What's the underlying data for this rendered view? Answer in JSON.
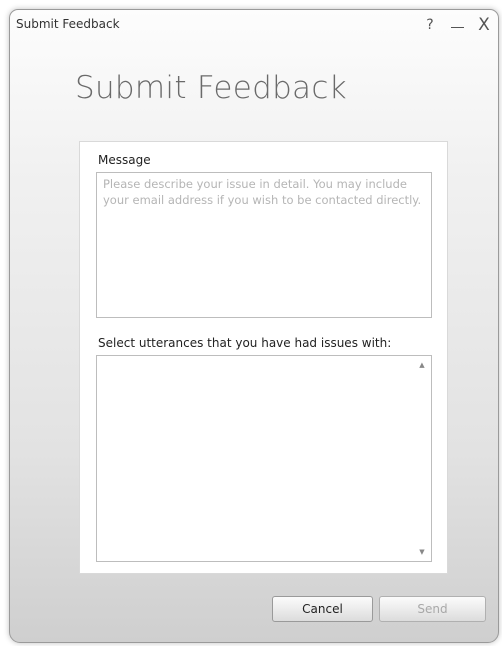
{
  "window": {
    "title": "Submit Feedback",
    "help_label": "?",
    "close_label": "X"
  },
  "page": {
    "heading": "Submit Feedback"
  },
  "form": {
    "message_label": "Message",
    "message_placeholder": "Please describe your issue in detail. You may include your email address if you wish to be contacted directly.",
    "message_value": "",
    "utterances_label": "Select utterances that you have had issues with:",
    "utterances_items": []
  },
  "buttons": {
    "cancel_label": "Cancel",
    "send_label": "Send",
    "send_enabled": false
  },
  "icons": {
    "scroll_up": "scroll-up-arrow-icon",
    "scroll_down": "scroll-down-arrow-icon"
  }
}
